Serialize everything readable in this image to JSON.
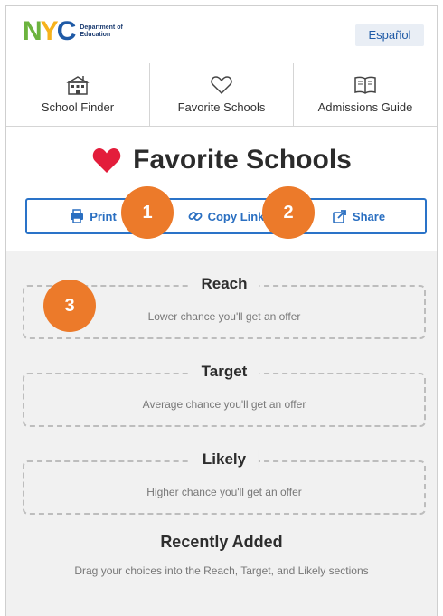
{
  "header": {
    "logo_letters": [
      "N",
      "Y",
      "C"
    ],
    "logo_line1": "Department of",
    "logo_line2": "Education",
    "language_link": "Español"
  },
  "nav": {
    "items": [
      {
        "label": "School Finder",
        "icon": "school-building-icon"
      },
      {
        "label": "Favorite Schools",
        "icon": "heart-outline-icon"
      },
      {
        "label": "Admissions Guide",
        "icon": "book-icon"
      }
    ]
  },
  "page": {
    "title": "Favorite Schools",
    "heart_color": "#e31d3b"
  },
  "actions": {
    "print": "Print",
    "copy_link": "Copy Link",
    "share": "Share",
    "accent": "#2a73c8"
  },
  "sections": [
    {
      "title": "Reach",
      "subtitle": "Lower chance you'll get an offer"
    },
    {
      "title": "Target",
      "subtitle": "Average chance you'll get an offer"
    },
    {
      "title": "Likely",
      "subtitle": "Higher chance you'll get an offer"
    }
  ],
  "recent": {
    "title": "Recently Added",
    "subtitle": "Drag your choices into the Reach, Target, and Likely sections"
  },
  "markers": [
    "1",
    "2",
    "3"
  ],
  "marker_color": "#ec7a2a"
}
